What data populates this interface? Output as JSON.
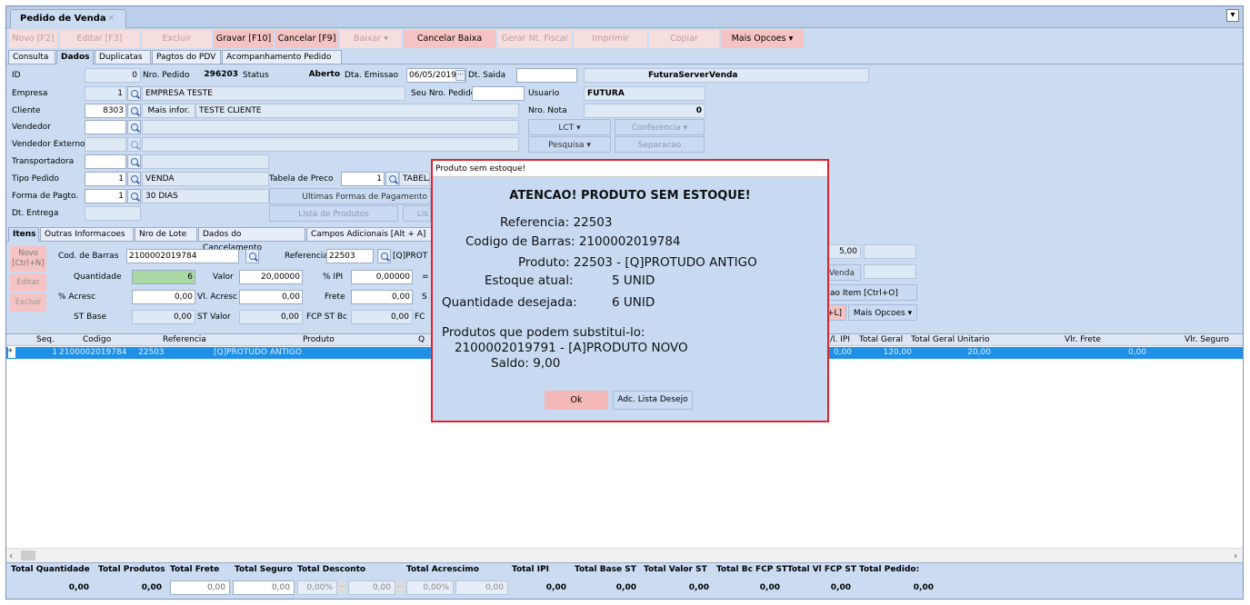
{
  "window": {
    "tab_title": "Pedido de Venda",
    "close_glyph": "✕",
    "dropdown_glyph": "▾"
  },
  "toolbar": {
    "novo": "Novo [F2]",
    "editar": "Editar [F3]",
    "excluir": "Excluir",
    "gravar": "Gravar [F10]",
    "cancelar": "Cancelar [F9]",
    "baixar": "Baixar",
    "cancelar_baixa": "Cancelar Baixa",
    "gerar_nf": "Gerar Nt. Fiscal",
    "imprimir": "Imprimir",
    "copiar": "Copiar",
    "mais_opcoes": "Mais Opcoes"
  },
  "tabs": [
    "Consulta",
    "Dados",
    "Duplicatas",
    "Pagtos do PDV",
    "Acompanhamento Pedido"
  ],
  "active_tab": "Dados",
  "form": {
    "id_label": "ID",
    "id_value": "0",
    "nro_pedido_label": "Nro. Pedido",
    "nro_pedido_value": "296203",
    "status_label": "Status",
    "status_value": "Aberto",
    "dta_emissao_label": "Dta. Emissao",
    "dta_emissao_value": "06/05/2019",
    "dt_saida_label": "Dt. Saida",
    "dt_saida_value": "",
    "server_value": "FuturaServer",
    "venda_value": "Venda",
    "empresa_label": "Empresa",
    "empresa_code": "1",
    "empresa_name": "EMPRESA TESTE",
    "seu_nro_label": "Seu Nro. Pedido",
    "usuario_label": "Usuario",
    "usuario_value": "FUTURA",
    "cliente_label": "Cliente",
    "cliente_code": "8303",
    "mais_infor": "Mais infor.",
    "cliente_name": "TESTE CLIENTE",
    "nro_nota_label": "Nro. Nota",
    "nro_nota_value": "0",
    "vendedor_label": "Vendedor",
    "vendedor_externo_label": "Vendedor Externo",
    "transportadora_label": "Transportadora",
    "tipo_pedido_label": "Tipo Pedido",
    "tipo_pedido_code": "1",
    "tipo_pedido_name": "VENDA",
    "tabela_preco_label": "Tabela de Preco",
    "tabela_preco_code": "1",
    "tabela_preco_name": "TABELA",
    "forma_pagto_label": "Forma de Pagto.",
    "forma_pagto_code": "1",
    "forma_pagto_name": "30 DIAS",
    "ultimas_formas": "Ultimas Formas de Pagamento",
    "dt_entrega_label": "Dt. Entrega",
    "lista_produtos": "Lista de Produtos",
    "lis": "Lis",
    "lct": "LCT",
    "conferencia": "Conferencia",
    "pesquisa": "Pesquisa",
    "separacao": "Separacao"
  },
  "item_tabs": [
    "Itens",
    "Outras Informacoes",
    "Nro de Lote",
    "Dados do Cancelamento",
    "Campos Adicionais [Alt + A]"
  ],
  "item": {
    "novo": "Novo\n[Ctrl+N]",
    "editar": "Editar",
    "excluir": "Excluir",
    "cod_barras_label": "Cod. de Barras",
    "cod_barras_value": "2100002019784",
    "referencia_label": "Referencia",
    "referencia_value": "22503",
    "produto_partial": "[Q]PROT",
    "quantidade_label": "Quantidade",
    "quantidade_value": "6",
    "valor_label": "Valor",
    "valor_value": "20,00000",
    "ipi_label": "% IPI",
    "ipi_value": "0,00000",
    "eq": "=",
    "acresc_label": "% Acresc",
    "acresc_value": "0,00",
    "vl_acresc_label": "Vl. Acresc",
    "vl_acresc_value": "0,00",
    "frete_label": "Frete",
    "frete_value": "0,00",
    "s": "S",
    "st_base_label": "ST Base",
    "st_base_value": "0,00",
    "st_valor_label": "ST Valor",
    "st_valor_value": "0,00",
    "fcp_label": "FCP ST Bc",
    "fcp_value": "0,00",
    "fc": "FC",
    "right_value": "5,00",
    "venda_btn": "Venda",
    "cao_item": "cao Item [Ctrl+O]",
    "l_btn": "+L]",
    "mais_opcoes": "Mais Opcoes"
  },
  "grid": {
    "headers": {
      "seq": "Seq.",
      "codigo": "Codigo",
      "referencia": "Referencia",
      "produto": "Produto",
      "q": "Q",
      "vl_ipi": "/l. IPI",
      "total_geral": "Total Geral",
      "total_geral_unit": "Total Geral Unitario",
      "vlr_frete": "Vlr. Frete",
      "vlr_seguro": "Vlr. Seguro"
    },
    "row": {
      "marker": "*",
      "seq": "1",
      "codigo": "2100002019784",
      "referencia": "22503",
      "produto": "[Q]PROTUDO ANTIGO",
      "vl_ipi": "0,00",
      "total_geral": "120,00",
      "total_geral_unit": "20,00",
      "vlr_frete": "0,00"
    }
  },
  "totals": {
    "labels": [
      "Total Quantidade",
      "Total Produtos",
      "Total Frete",
      "Total Seguro",
      "Total Desconto",
      "Total Acrescimo",
      "Total IPI",
      "Total Base ST",
      "Total Valor ST",
      "Total Bc FCP ST",
      "Total Vl FCP ST",
      "Total Pedido:"
    ],
    "quantidade": "0,00",
    "produtos": "0,00",
    "frete": "0,00",
    "seguro": "0,00",
    "desc_pct": "0,00%",
    "desc_val": "0,00",
    "acr_pct": "0,00%",
    "acr_val": "0,00",
    "ipi": "0,00",
    "base_st": "0,00",
    "valor_st": "0,00",
    "bc_fcp": "0,00",
    "vl_fcp": "0,00",
    "pedido": "0,00"
  },
  "dialog": {
    "title": "Produto sem estoque!",
    "heading": "ATENCAO! PRODUTO SEM ESTOQUE!",
    "referencia": "Referencia: 22503",
    "codigo_barras": "Codigo de Barras: 2100002019784",
    "produto": "Produto: 22503 - [Q]PROTUDO ANTIGO",
    "estoque_label": "Estoque atual:",
    "estoque_value": "5  UNID",
    "desejada_label": "Quantidade desejada:",
    "desejada_value": "6  UNID",
    "substitutos_label": "Produtos que podem substitui-lo:",
    "substituto": "2100002019791 - [A]PRODUTO NOVO",
    "saldo": "Saldo: 9,00",
    "ok": "Ok",
    "adc_lista": "Adc. Lista Desejo"
  },
  "colors": {
    "background": "#cbdcf2",
    "toolbar": "#f5c3c3",
    "selected_row": "#1e90e6",
    "dialog_border": "#e0242c"
  }
}
